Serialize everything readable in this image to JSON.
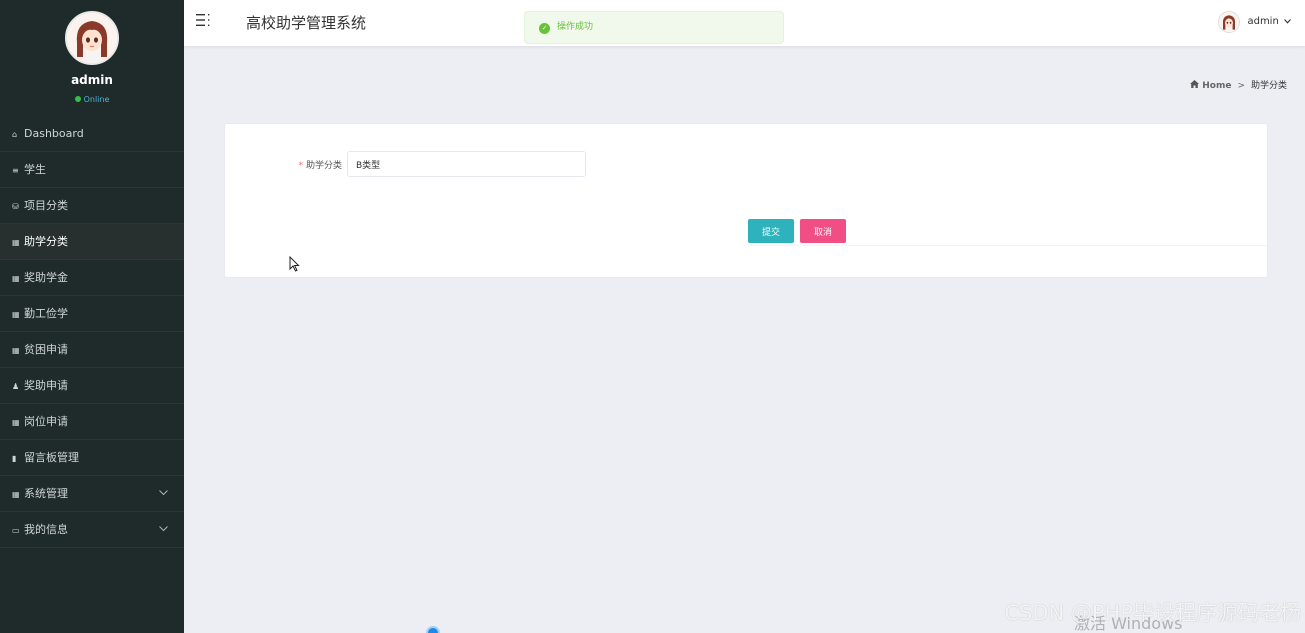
{
  "sidebar": {
    "username": "admin",
    "status": "Online",
    "items": [
      {
        "icon": "home-icon",
        "glyph": "⌂",
        "label": "Dashboard",
        "active": false,
        "expandable": false
      },
      {
        "icon": "list-icon",
        "glyph": "≡",
        "label": "学生",
        "active": false,
        "expandable": false
      },
      {
        "icon": "database-icon",
        "glyph": "⛁",
        "label": "项目分类",
        "active": false,
        "expandable": false
      },
      {
        "icon": "grid-icon",
        "glyph": "▦",
        "label": "助学分类",
        "active": true,
        "expandable": false
      },
      {
        "icon": "grid-icon",
        "glyph": "▦",
        "label": "奖助学金",
        "active": false,
        "expandable": false
      },
      {
        "icon": "table-icon",
        "glyph": "▦",
        "label": "勤工俭学",
        "active": false,
        "expandable": false
      },
      {
        "icon": "grid-icon",
        "glyph": "▦",
        "label": "贫困申请",
        "active": false,
        "expandable": false
      },
      {
        "icon": "user-icon",
        "glyph": "♟",
        "label": "奖助申请",
        "active": false,
        "expandable": false
      },
      {
        "icon": "grid-icon",
        "glyph": "▦",
        "label": "岗位申请",
        "active": false,
        "expandable": false
      },
      {
        "icon": "bar-chart-icon",
        "glyph": "▮",
        "label": "留言板管理",
        "active": false,
        "expandable": false
      },
      {
        "icon": "grid-icon",
        "glyph": "▦",
        "label": "系统管理",
        "active": false,
        "expandable": true
      },
      {
        "icon": "id-card-icon",
        "glyph": "▭",
        "label": "我的信息",
        "active": false,
        "expandable": true
      }
    ]
  },
  "header": {
    "title": "高校助学管理系统",
    "user": "admin"
  },
  "toast": {
    "message": "操作成功"
  },
  "breadcrumb": {
    "home": "Home",
    "separator": ">",
    "current": "助学分类"
  },
  "form": {
    "field_label": "助学分类",
    "field_value": "B类型",
    "submit_label": "提交",
    "cancel_label": "取消"
  },
  "watermark": {
    "text": "CSDN @PHP毕设程序源码老杨",
    "activate": "激活 Windows"
  },
  "colors": {
    "sidebar_bg": "#1f2a2a",
    "submit": "#2eb3bd",
    "cancel": "#f24e86",
    "success": "#67c23a",
    "status_online": "#35c04a"
  }
}
